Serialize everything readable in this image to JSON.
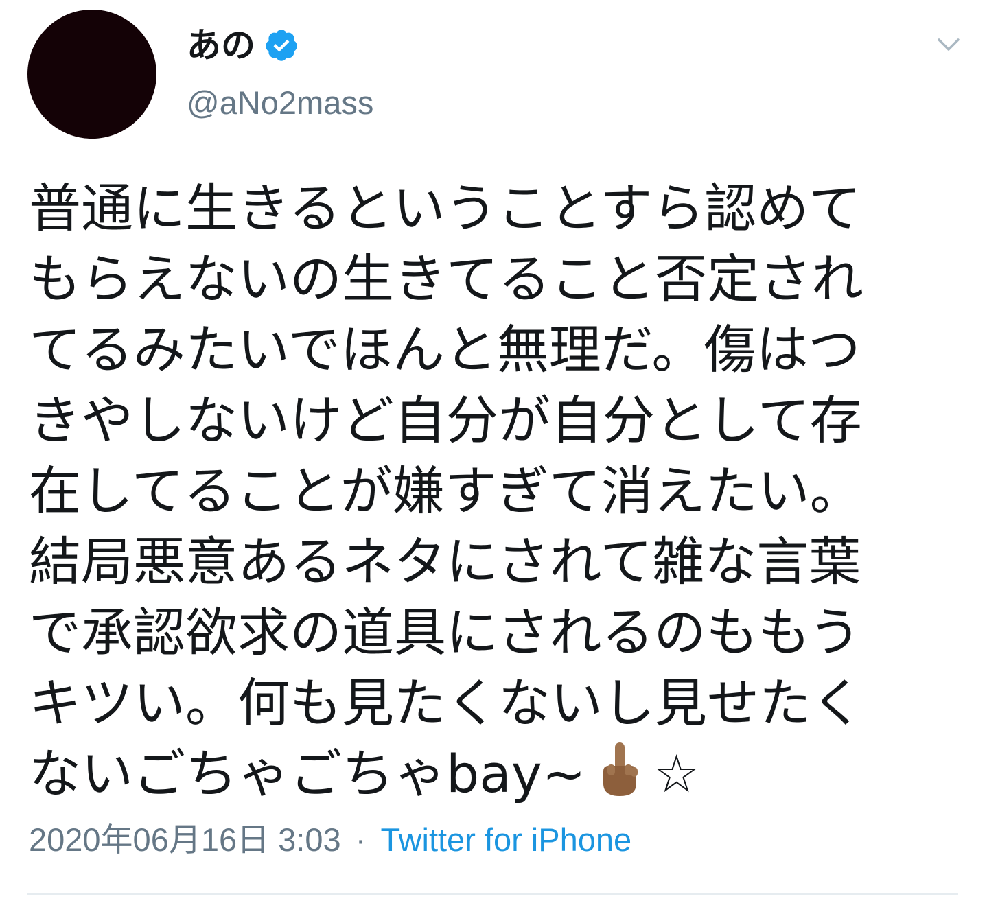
{
  "user": {
    "display_name": "あの",
    "handle": "@aNo2mass",
    "verified": true,
    "avatar_color": "#140206"
  },
  "tweet": {
    "lines": [
      "普通に生きるということすら認めて",
      "もらえないの生きてること否定され",
      "てるみたいでほんと無理だ。傷はつ",
      "きやしないけど自分が自分として存",
      "在してることが嫌すぎて消えたい。",
      "結局悪意あるネタにされて雑な言葉",
      "で承認欲求の道具にされるのももう",
      "キツい。何も見たくないし見せたく",
      "ないごちゃごちゃbay~"
    ],
    "trailing_star": "☆",
    "emoji_icon": "middle-finger-icon"
  },
  "meta": {
    "timestamp": "2020年06月16日 3:03",
    "separator": "·",
    "source": "Twitter for iPhone"
  },
  "colors": {
    "text": "#14171a",
    "secondary": "#657786",
    "link": "#1b95e0",
    "verified": "#1da1f2",
    "divider": "#e6ecf0"
  }
}
